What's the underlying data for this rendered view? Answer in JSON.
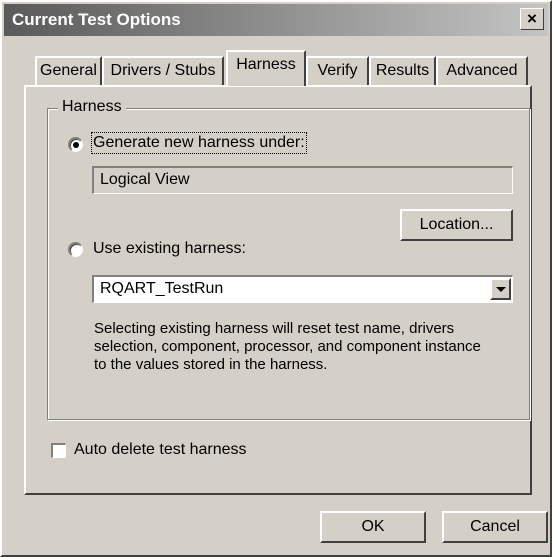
{
  "window": {
    "title": "Current Test Options",
    "close_glyph": "×"
  },
  "tabs": [
    {
      "label": "General",
      "active": false
    },
    {
      "label": "Drivers / Stubs",
      "active": false
    },
    {
      "label": "Harness",
      "active": true
    },
    {
      "label": "Verify",
      "active": false
    },
    {
      "label": "Results",
      "active": false
    },
    {
      "label": "Advanced",
      "active": false
    }
  ],
  "harness_group": {
    "label": "Harness",
    "generate_option": {
      "label": "Generate new harness under:",
      "selected": true
    },
    "location_value": "Logical View",
    "location_button": "Location...",
    "existing_option": {
      "label": "Use existing harness:",
      "selected": false
    },
    "existing_select": {
      "value": "RQART_TestRun"
    },
    "description": "Selecting existing harness will reset test name, drivers selection, component, processor, and component instance to the values stored in the harness."
  },
  "auto_delete": {
    "label": "Auto delete test harness",
    "checked": false
  },
  "footer": {
    "ok_label": "OK",
    "cancel_label": "Cancel"
  },
  "colors": {
    "dialog_face": "#d4d0c8",
    "title_gradient_start": "#5a5a5a",
    "title_gradient_end": "#c4c4c4"
  }
}
